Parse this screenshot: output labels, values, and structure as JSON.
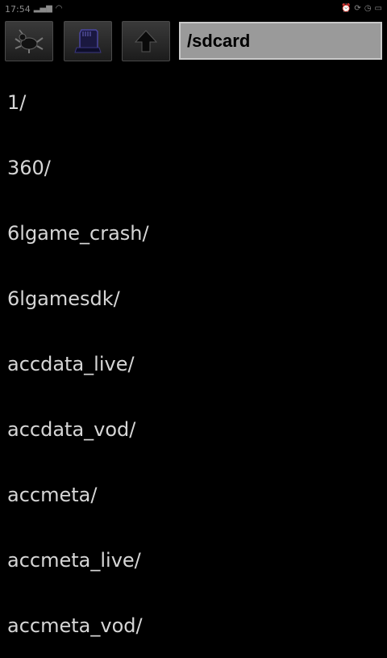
{
  "status_bar": {
    "time": "17:54",
    "icons_left": [
      "signal-icon",
      "wifi-icon"
    ],
    "icons_right": [
      "alarm-icon",
      "sync-icon",
      "clock-icon",
      "battery-icon"
    ]
  },
  "toolbar": {
    "buttons": [
      {
        "name": "bug-icon"
      },
      {
        "name": "sdcard-icon"
      },
      {
        "name": "up-arrow-icon"
      }
    ],
    "path_value": "/sdcard"
  },
  "files": [
    "1/",
    "360/",
    "6lgame_crash/",
    "6lgamesdk/",
    "accdata_live/",
    "accdata_vod/",
    "accmeta/",
    "accmeta_live/",
    "accmeta_vod/"
  ],
  "colors": {
    "background": "#000000",
    "text": "#d6d6d6",
    "path_field": "#9a9a9a"
  }
}
